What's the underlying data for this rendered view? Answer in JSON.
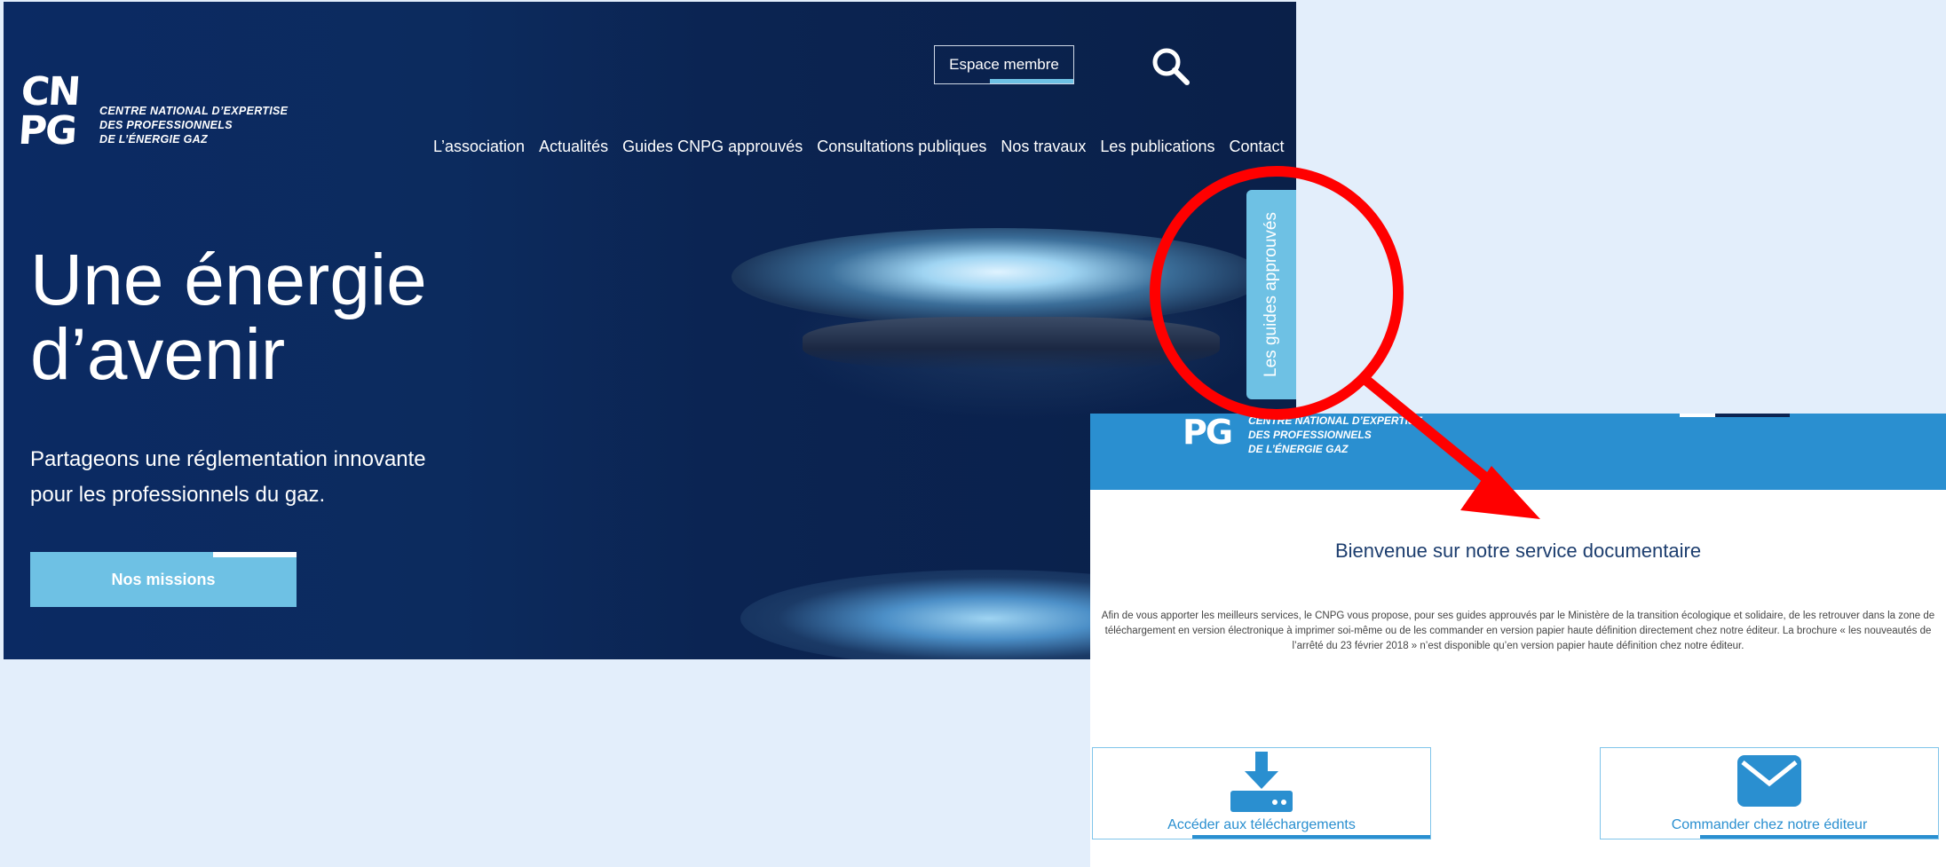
{
  "home": {
    "logo_mark": "CN PG",
    "logo_lines": [
      "CENTRE NATIONAL D’EXPERTISE",
      "DES PROFESSIONNELS",
      "DE L’ÉNERGIE GAZ"
    ],
    "member_button": "Espace membre",
    "nav": [
      "L’association",
      "Actualités",
      "Guides CNPG approuvés",
      "Consultations publiques",
      "Nos travaux",
      "Les publications",
      "Contact"
    ],
    "hero_title_line1": "Une énergie",
    "hero_title_line2": "d’avenir",
    "hero_sub_line1": "Partageons une réglementation innovante",
    "hero_sub_line2": "pour les professionnels du gaz.",
    "missions_button": "Nos missions",
    "side_tab": "Les guides approuvés"
  },
  "doc": {
    "logo_mark": "PG",
    "logo_lines": [
      "CENTRE NATIONAL D’EXPERTISE",
      "DES PROFESSIONNELS",
      "DE L’ÉNERGIE GAZ"
    ],
    "title": "Bienvenue sur notre service documentaire",
    "paragraph": "Afin de vous apporter les meilleurs services, le CNPG vous propose, pour ses guides approuvés par le Ministère de la transition écologique et solidaire, de les retrouver dans la zone de téléchargement en version électronique à imprimer soi-même ou de les commander en version papier haute définition directement chez notre éditeur. La brochure « les nouveautés de l’arrêté du 23 février 2018 » n’est disponible qu’en version papier haute définition chez notre éditeur.",
    "download_card": "Accéder aux téléchargements",
    "order_card": "Commander chez notre éditeur"
  },
  "colors": {
    "hero_bg": "#0b2a63",
    "accent_light_blue": "#6ec1e4",
    "doc_header_blue": "#2a8fd0",
    "annotation_red": "#ff0000"
  }
}
